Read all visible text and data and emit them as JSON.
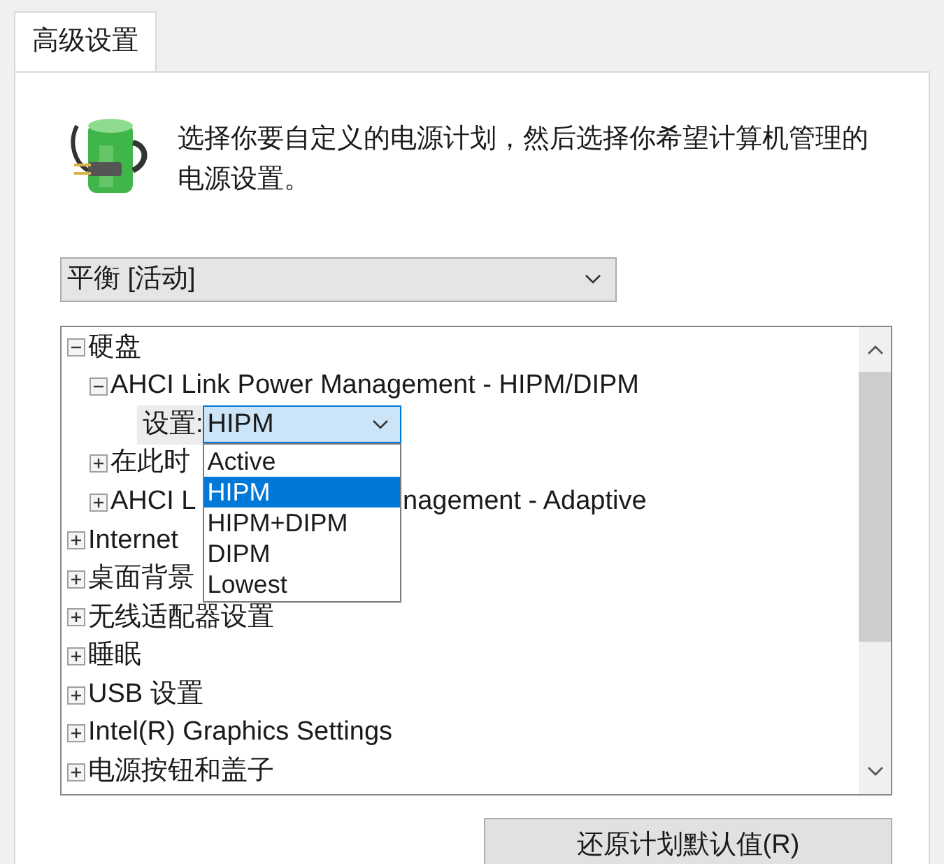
{
  "tab": {
    "label": "高级设置",
    "selected": true
  },
  "description": "选择你要自定义的电源计划，然后选择你希望计算机管理的电源设置。",
  "plan_select": {
    "value": "平衡 [活动]"
  },
  "tree": {
    "items": [
      {
        "kind": "node",
        "label": "硬盘",
        "expanded": true,
        "children": [
          {
            "kind": "node",
            "label": "AHCI Link Power Management - HIPM/DIPM",
            "expanded": true,
            "children": [
              {
                "kind": "setting",
                "label": "设置:",
                "value": "HIPM",
                "open": true,
                "options": [
                  {
                    "label": "Active",
                    "selected": false
                  },
                  {
                    "label": "HIPM",
                    "selected": true
                  },
                  {
                    "label": "HIPM+DIPM",
                    "selected": false
                  },
                  {
                    "label": "DIPM",
                    "selected": false
                  },
                  {
                    "label": "Lowest",
                    "selected": false
                  }
                ]
              }
            ]
          },
          {
            "kind": "node",
            "label": "在此时",
            "expanded": false
          },
          {
            "kind": "node",
            "label": "AHCI L",
            "label_after": "nagement - Adaptive",
            "expanded": false
          }
        ]
      },
      {
        "kind": "node",
        "label": "Internet",
        "expanded": false
      },
      {
        "kind": "node",
        "label": "桌面背景",
        "expanded": false
      },
      {
        "kind": "node",
        "label": "无线适配器设置",
        "expanded": false
      },
      {
        "kind": "node",
        "label": "睡眠",
        "expanded": false
      },
      {
        "kind": "node",
        "label": "USB 设置",
        "expanded": false
      },
      {
        "kind": "node",
        "label": "Intel(R) Graphics Settings",
        "expanded": false
      },
      {
        "kind": "node",
        "label": "电源按钮和盖子",
        "expanded": false
      }
    ]
  },
  "restore_button": "还原计划默认值(R)"
}
